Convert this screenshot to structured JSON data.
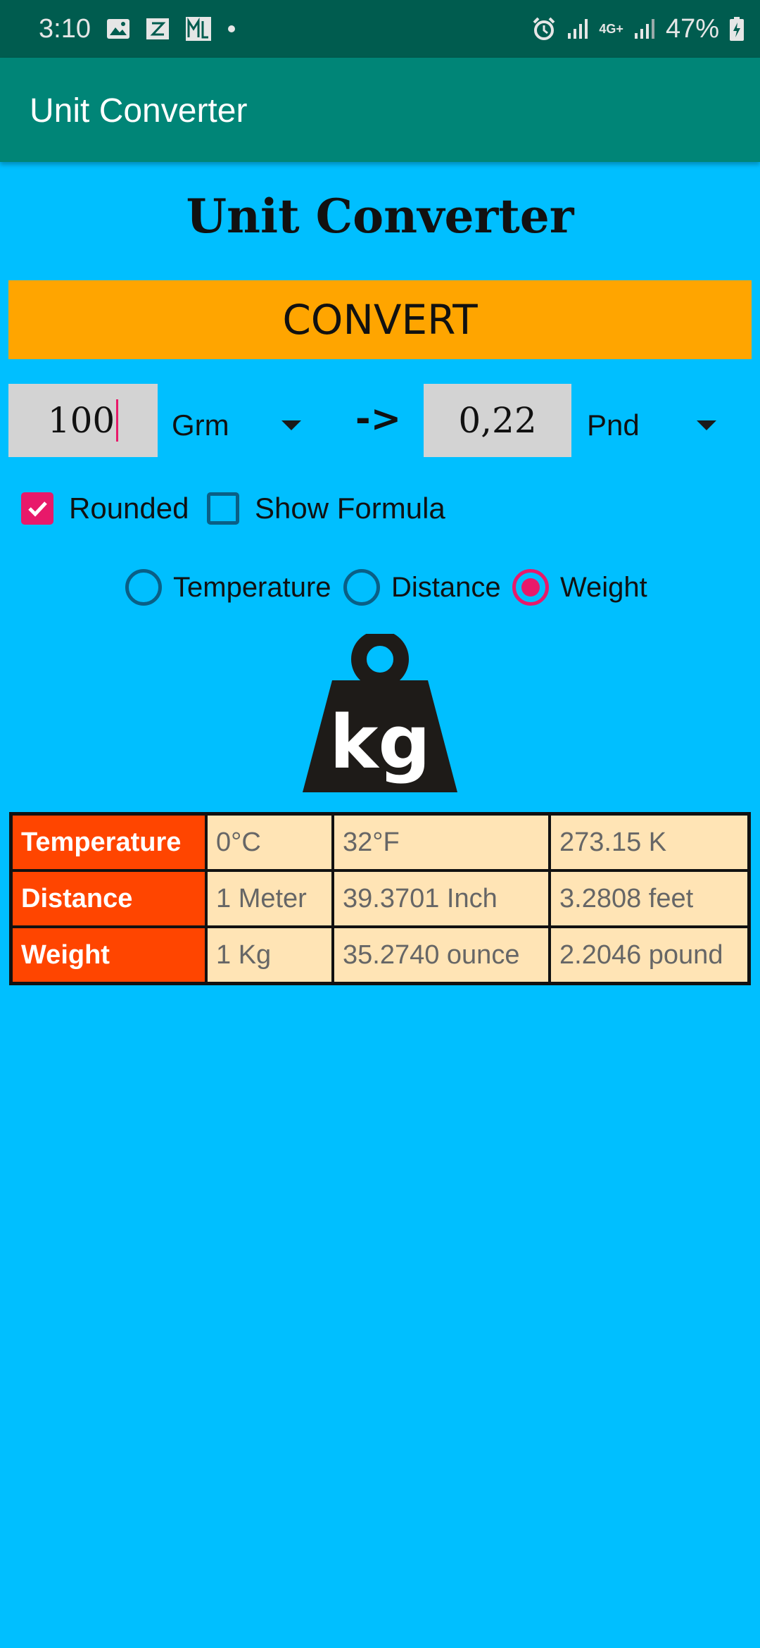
{
  "status_bar": {
    "time": "3:10",
    "battery": "47%",
    "network_label": "4G+",
    "icons": [
      "image-icon",
      "z-app-icon",
      "ml-app-icon",
      "dot-icon",
      "alarm-icon",
      "signal-icon",
      "battery-icon"
    ]
  },
  "app_bar": {
    "title": "Unit Converter"
  },
  "heading": "Unit Converter",
  "convert_button": {
    "label": "CONVERT"
  },
  "converter": {
    "input_value": "100",
    "from_unit": "Grm",
    "arrow": "->",
    "output_value": "0,22",
    "to_unit": "Pnd"
  },
  "options": {
    "rounded": {
      "label": "Rounded",
      "checked": true
    },
    "show_formula": {
      "label": "Show Formula",
      "checked": false
    }
  },
  "categories": [
    {
      "label": "Temperature",
      "selected": false
    },
    {
      "label": "Distance",
      "selected": false
    },
    {
      "label": "Weight",
      "selected": true
    }
  ],
  "weight_image": {
    "text": "kg",
    "icon": "kettlebell-weight-icon"
  },
  "reference_table": [
    {
      "category": "Temperature",
      "values": [
        "0°C",
        "32°F",
        "273.15 K"
      ]
    },
    {
      "category": "Distance",
      "values": [
        "1 Meter",
        "39.3701 Inch",
        "3.2808 feet"
      ]
    },
    {
      "category": "Weight",
      "values": [
        "1 Kg",
        "35.2740 ounce",
        "2.2046 pound"
      ]
    }
  ],
  "colors": {
    "background": "#00bfff",
    "status_bar": "#005c4f",
    "app_bar": "#008577",
    "convert_button": "#ffa500",
    "accent": "#e8196a",
    "table_header": "#ff4500",
    "table_cell": "#ffe4b5"
  }
}
